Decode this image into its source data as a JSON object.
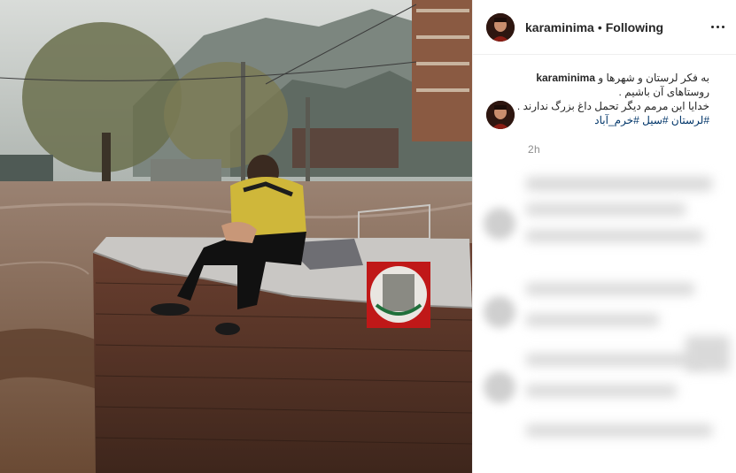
{
  "post": {
    "username": "karaminima",
    "separator": "•",
    "follow_status": "Following",
    "more_icon": "more-horizontal-icon",
    "caption": {
      "username": "karaminima",
      "line1": "به فکر لرستان و شهرها و",
      "line2": "روستاهای آن باشیم .",
      "line3": "خدایا این مرمم دیگر تحمل داغ بزرگ ندارند .",
      "hashtags": "#لرستان #سیل #خرم_آباد"
    },
    "timestamp": "2h"
  },
  "colors": {
    "hashtag": "#003569",
    "timestamp": "#8e8e8e",
    "border": "#efefef"
  }
}
